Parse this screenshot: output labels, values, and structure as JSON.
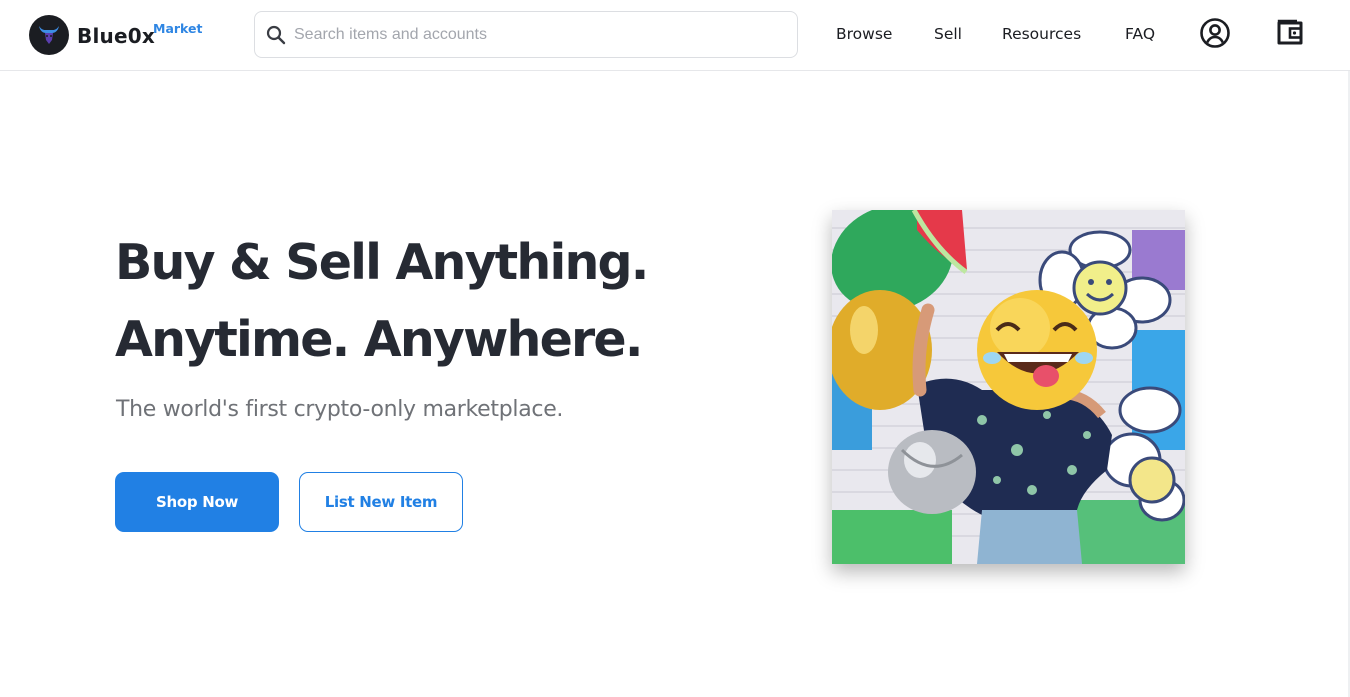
{
  "header": {
    "brand_name": "Blue0x",
    "brand_sub": "Market",
    "search_placeholder": "Search items and accounts",
    "nav": [
      {
        "label": "Browse"
      },
      {
        "label": "Sell"
      },
      {
        "label": "Resources"
      },
      {
        "label": "FAQ"
      }
    ],
    "icons": [
      "account-icon",
      "wallet-icon"
    ]
  },
  "hero": {
    "title_line1": "Buy & Sell Anything.",
    "title_line2": "Anytime. Anywhere.",
    "subtitle": "The world's first crypto-only marketplace.",
    "primary_button": "Shop Now",
    "secondary_button": "List New Item"
  },
  "colors": {
    "accent": "#2180e4",
    "brand_sub": "#2f86e3",
    "heading": "#262a33",
    "subtext": "#6f7277"
  }
}
